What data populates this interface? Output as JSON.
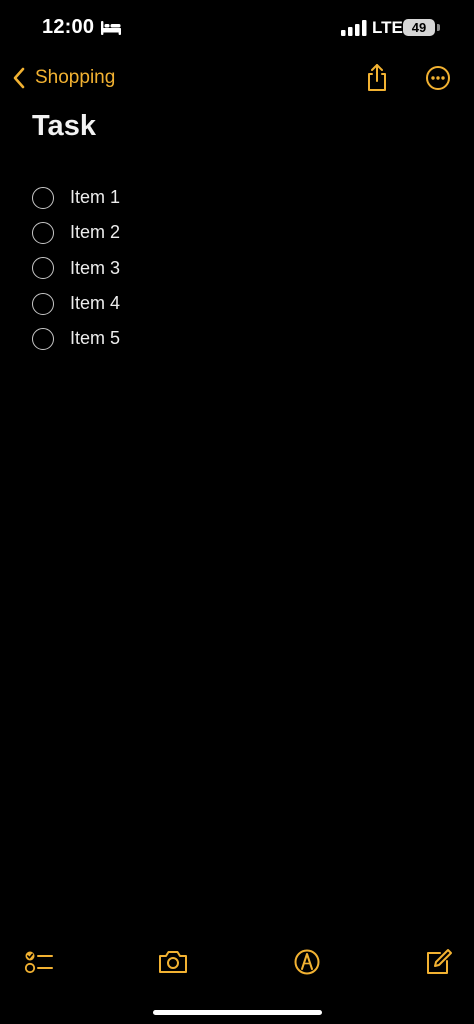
{
  "status_bar": {
    "time": "12:00",
    "network": "LTE",
    "battery_level": "49",
    "icons": [
      "bed-icon",
      "cellular-signal-icon",
      "battery-icon"
    ]
  },
  "nav": {
    "back_label": "Shopping",
    "icons": [
      "chevron-left-icon",
      "share-icon",
      "more-ellipsis-icon"
    ]
  },
  "note": {
    "title": "Task",
    "items": [
      {
        "label": "Item 1",
        "checked": false
      },
      {
        "label": "Item 2",
        "checked": false
      },
      {
        "label": "Item 3",
        "checked": false
      },
      {
        "label": "Item 4",
        "checked": false
      },
      {
        "label": "Item 5",
        "checked": false
      }
    ]
  },
  "toolbar": {
    "icons": [
      "checklist-icon",
      "camera-icon",
      "markup-pen-icon",
      "compose-icon"
    ]
  },
  "colors": {
    "accent": "#f2b232",
    "background": "#000000",
    "text": "#ededed",
    "checkbox_border": "#c8c8c8"
  }
}
